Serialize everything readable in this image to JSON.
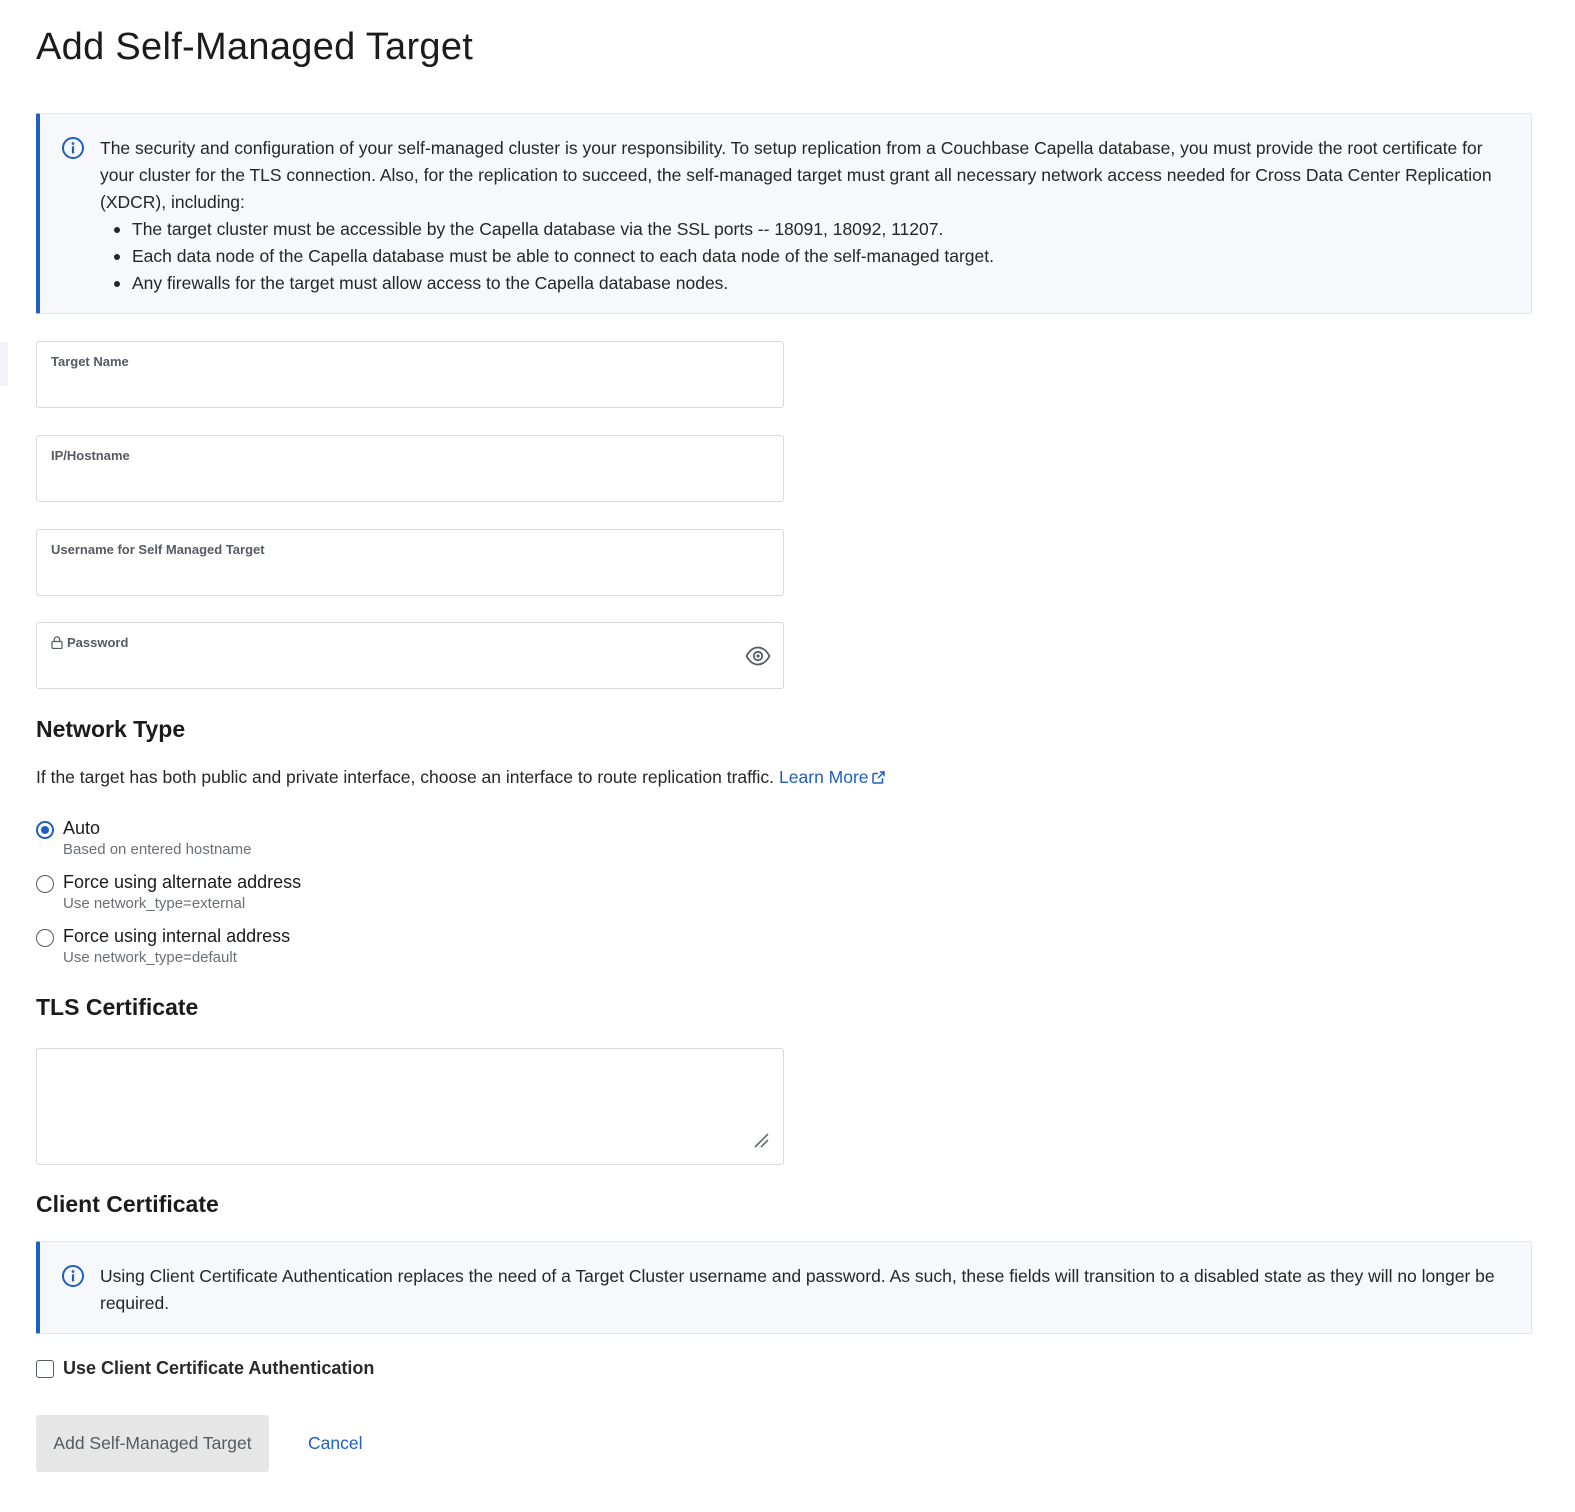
{
  "page": {
    "title": "Add Self-Managed Target"
  },
  "security_notice": {
    "icon": "info-icon",
    "text": "The security and configuration of your self-managed cluster is your responsibility. To setup replication from a Couchbase Capella database, you must provide the root certificate for your cluster for the TLS connection. Also, for the replication to succeed, the self-managed target must grant all necessary network access needed for Cross Data Center Replication (XDCR), including:",
    "bullets": [
      "The target cluster must be accessible by the Capella database via the SSL ports -- 18091, 18092, 11207.",
      "Each data node of the Capella database must be able to connect to each data node of the self-managed target.",
      "Any firewalls for the target must allow access to the Capella database nodes."
    ]
  },
  "form": {
    "target_name": {
      "label": "Target Name",
      "value": ""
    },
    "hostname": {
      "label": "IP/Hostname",
      "value": ""
    },
    "username": {
      "label": "Username for Self Managed Target",
      "value": ""
    },
    "password": {
      "label": "Password",
      "value": "",
      "lock_icon": "lock-icon",
      "toggle_icon": "eye-icon"
    }
  },
  "network_type": {
    "heading": "Network Type",
    "description": "If the target has both public and private interface, choose an interface to route replication traffic.",
    "learn_more": "Learn More",
    "options": [
      {
        "label": "Auto",
        "sub": "Based on entered hostname",
        "selected": true
      },
      {
        "label": "Force using alternate address",
        "sub": "Use network_type=external",
        "selected": false
      },
      {
        "label": "Force using internal address",
        "sub": "Use network_type=default",
        "selected": false
      }
    ]
  },
  "tls": {
    "heading": "TLS Certificate",
    "value": ""
  },
  "client_certificate": {
    "heading": "Client Certificate",
    "notice": "Using Client Certificate Authentication replaces the need of a Target Cluster username and password. As such, these fields will transition to a disabled state as they will no longer be required.",
    "checkbox_label": "Use Client Certificate Authentication",
    "checked": false
  },
  "actions": {
    "submit_label": "Add Self-Managed Target",
    "cancel_label": "Cancel"
  },
  "colors": {
    "accent": "#1f5fbf",
    "notice_bg": "#f7f8fb",
    "disabled_button_bg": "#e6e6e6"
  }
}
